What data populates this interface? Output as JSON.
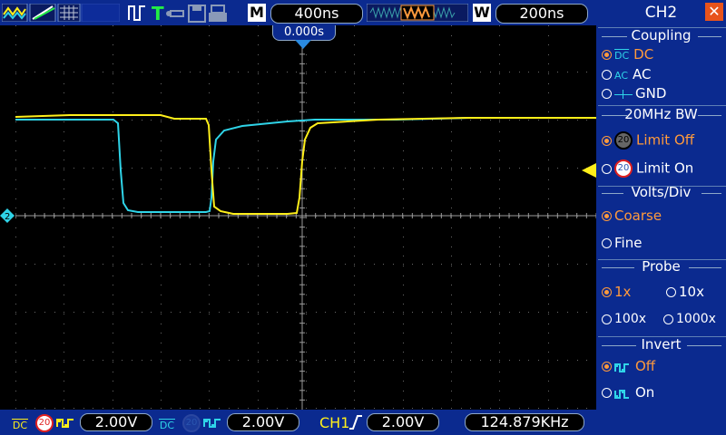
{
  "topbar": {
    "timebase": "400ns",
    "mode_label": "M",
    "window_label": "W",
    "window_timebase": "200ns",
    "trigger_time": "0.000s"
  },
  "bottombar": {
    "ch1_coupling": "DC",
    "ch1_bw": "20",
    "ch1_volts": "2.00V",
    "ch2_coupling": "DC",
    "ch2_bw": "20",
    "ch2_volts": "2.00V",
    "trigger_source": "CH1",
    "trigger_level": "2.00V",
    "frequency": "124.879KHz"
  },
  "panel": {
    "title": "CH2",
    "coupling": {
      "title": "Coupling",
      "options": [
        {
          "icon_text": "DC",
          "label": "DC",
          "selected": true
        },
        {
          "icon_text": "AC",
          "label": "AC",
          "selected": false
        },
        {
          "icon_text": "",
          "label": "GND",
          "selected": false
        }
      ]
    },
    "bandwidth": {
      "title": "20MHz BW",
      "icon": "20",
      "options": [
        {
          "label": "Limit Off",
          "selected": true
        },
        {
          "label": "Limit On",
          "selected": false
        }
      ]
    },
    "volts_div": {
      "title": "Volts/Div",
      "options": [
        {
          "label": "Coarse",
          "selected": true
        },
        {
          "label": "Fine",
          "selected": false
        }
      ]
    },
    "probe": {
      "title": "Probe",
      "options": [
        {
          "label": "1x",
          "selected": true
        },
        {
          "label": "10x",
          "selected": false
        },
        {
          "label": "100x",
          "selected": false
        },
        {
          "label": "1000x",
          "selected": false
        }
      ]
    },
    "invert": {
      "title": "Invert",
      "options": [
        {
          "label": "Off",
          "selected": true
        },
        {
          "label": "On",
          "selected": false
        }
      ]
    }
  },
  "colors": {
    "ch1": "#ffef1a",
    "ch2": "#2fd4e8",
    "selected_option": "#ff9a3c",
    "panel_bg": "#0b2a8f"
  },
  "icons": {
    "top_left": [
      "waveform-yellow-icon",
      "line-green-icon",
      "grid-icon"
    ],
    "top_mid": [
      "pulse-icon",
      "trigger-t-icon",
      "usb-icon",
      "save-icon",
      "print-icon"
    ]
  }
}
